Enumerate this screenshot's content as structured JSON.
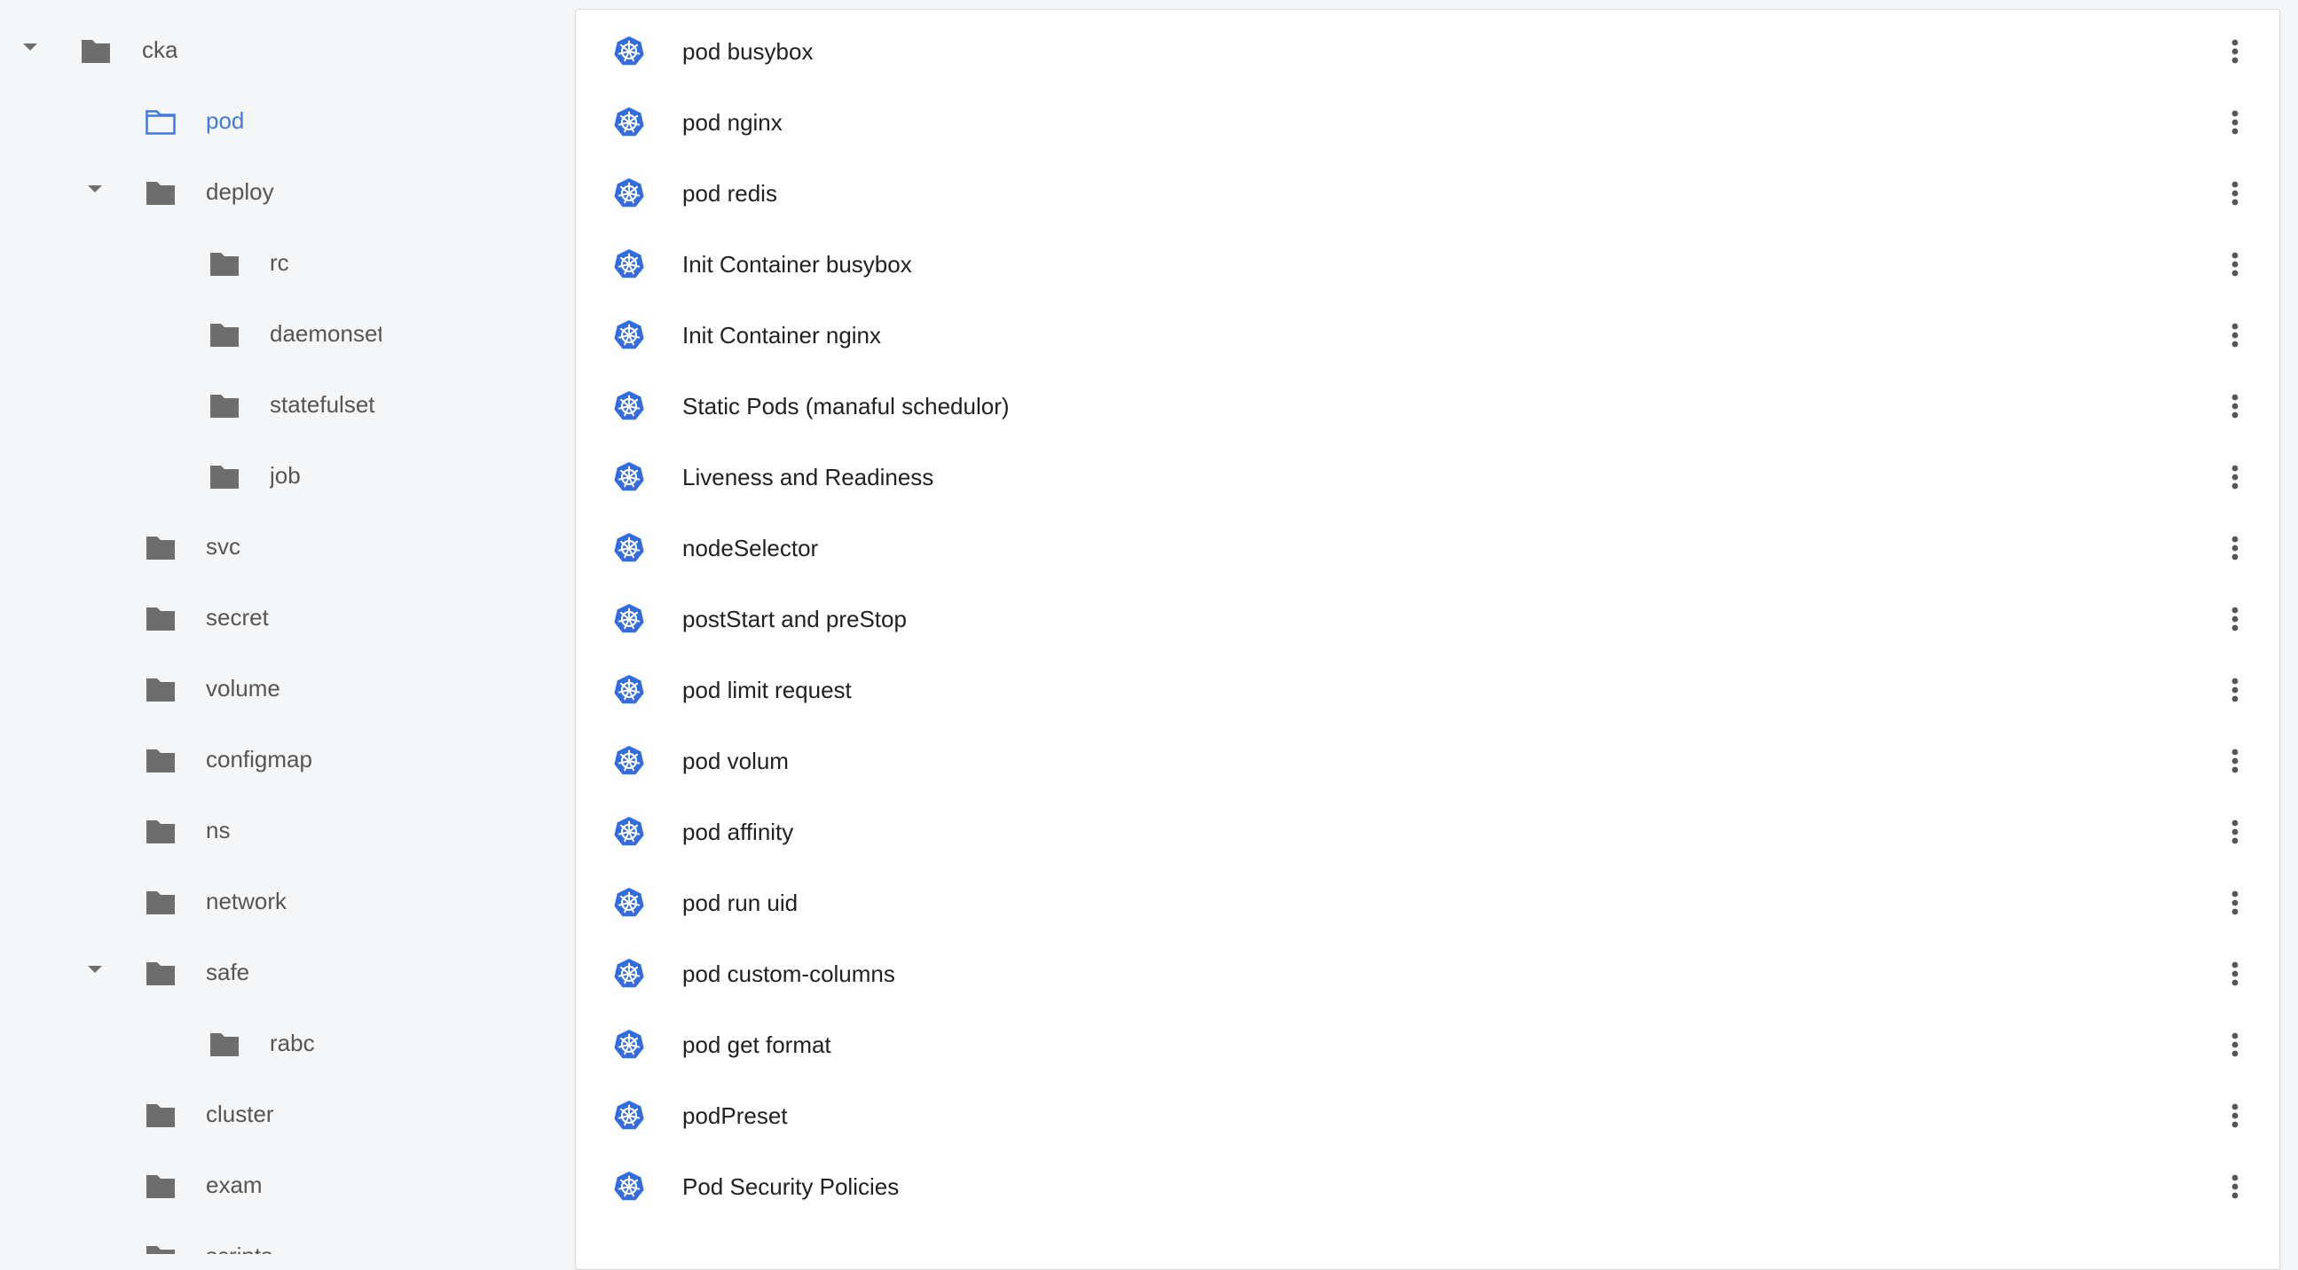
{
  "sidebar": {
    "tree": [
      {
        "label": "cka",
        "expanded": true,
        "selected": false
      },
      {
        "label": "pod",
        "expanded": false,
        "selected": true
      },
      {
        "label": "deploy",
        "expanded": true,
        "selected": false
      },
      {
        "label": "rc",
        "expanded": false,
        "selected": false
      },
      {
        "label": "daemonset",
        "expanded": false,
        "selected": false
      },
      {
        "label": "statefulset",
        "expanded": false,
        "selected": false
      },
      {
        "label": "job",
        "expanded": false,
        "selected": false
      },
      {
        "label": "svc",
        "expanded": false,
        "selected": false
      },
      {
        "label": "secret",
        "expanded": false,
        "selected": false
      },
      {
        "label": "volume",
        "expanded": false,
        "selected": false
      },
      {
        "label": "configmap",
        "expanded": false,
        "selected": false
      },
      {
        "label": "ns",
        "expanded": false,
        "selected": false
      },
      {
        "label": "network",
        "expanded": false,
        "selected": false
      },
      {
        "label": "safe",
        "expanded": true,
        "selected": false
      },
      {
        "label": "rabc",
        "expanded": false,
        "selected": false
      },
      {
        "label": "cluster",
        "expanded": false,
        "selected": false
      },
      {
        "label": "exam",
        "expanded": false,
        "selected": false
      },
      {
        "label": "scripts",
        "expanded": false,
        "selected": false
      }
    ]
  },
  "main": {
    "items": [
      {
        "title": "pod busybox"
      },
      {
        "title": "pod nginx"
      },
      {
        "title": "pod redis"
      },
      {
        "title": "Init Container busybox"
      },
      {
        "title": "Init Container nginx"
      },
      {
        "title": "Static Pods (manaful schedulor)"
      },
      {
        "title": "Liveness and Readiness"
      },
      {
        "title": "nodeSelector"
      },
      {
        "title": "postStart and preStop"
      },
      {
        "title": "pod limit request"
      },
      {
        "title": "pod volum"
      },
      {
        "title": "pod affinity"
      },
      {
        "title": "pod run uid"
      },
      {
        "title": "pod custom-columns"
      },
      {
        "title": "pod get format"
      },
      {
        "title": "podPreset"
      },
      {
        "title": "Pod Security Policies"
      }
    ],
    "item_icon": "kubernetes-icon",
    "more_icon": "more-vert-icon"
  },
  "colors": {
    "accent": "#3f7be0",
    "folder": "#6e6e6e",
    "k8s": "#326ce5",
    "background": "#f5f6f7"
  }
}
